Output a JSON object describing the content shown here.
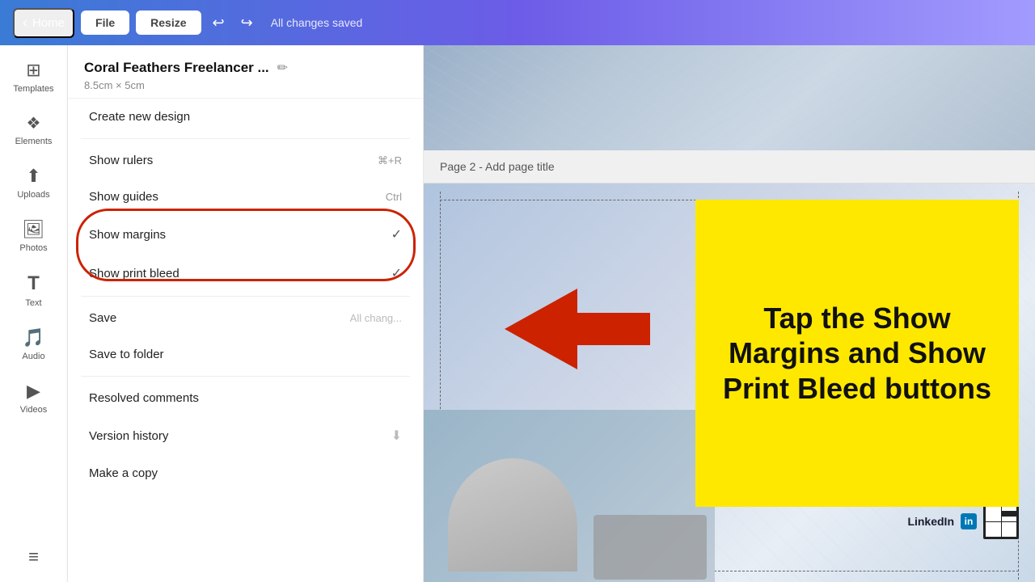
{
  "topbar": {
    "home_label": "Home",
    "file_label": "File",
    "resize_label": "Resize",
    "saved_status": "All changes saved",
    "undo_icon": "↩",
    "redo_icon": "↪",
    "chevron_left": "‹"
  },
  "sidebar": {
    "items": [
      {
        "id": "templates",
        "icon": "⊞",
        "label": "Templates"
      },
      {
        "id": "elements",
        "icon": "✦",
        "label": "Elements"
      },
      {
        "id": "uploads",
        "icon": "☁",
        "label": "Uploads"
      },
      {
        "id": "photos",
        "icon": "🖼",
        "label": "Photos"
      },
      {
        "id": "text",
        "icon": "T",
        "label": "Text"
      },
      {
        "id": "audio",
        "icon": "♪",
        "label": "Audio"
      },
      {
        "id": "videos",
        "icon": "▶",
        "label": "Videos"
      },
      {
        "id": "more",
        "icon": "≡",
        "label": ""
      }
    ]
  },
  "file_menu": {
    "title": "Coral Feathers Freelancer ...",
    "subtitle": "8.5cm × 5cm",
    "edit_icon": "✏",
    "items": [
      {
        "id": "create-new",
        "label": "Create new design",
        "shortcut": "",
        "check": false
      },
      {
        "id": "show-rulers",
        "label": "Show rulers",
        "shortcut": "⌘+R",
        "check": false
      },
      {
        "id": "show-guides",
        "label": "Show guides",
        "shortcut": "Ctrl",
        "check": false
      },
      {
        "id": "show-margins",
        "label": "Show margins",
        "shortcut": "",
        "check": true
      },
      {
        "id": "show-print-bleed",
        "label": "Show print bleed",
        "shortcut": "",
        "check": true
      },
      {
        "id": "save",
        "label": "Save",
        "faded": "All chang...",
        "check": false
      },
      {
        "id": "save-to-folder",
        "label": "Save to folder",
        "shortcut": "",
        "check": false
      },
      {
        "id": "resolved-comments",
        "label": "Resolved comments",
        "shortcut": "",
        "check": false
      },
      {
        "id": "version-history",
        "label": "Version history",
        "shortcut": "",
        "check": false
      },
      {
        "id": "make-copy",
        "label": "Make a copy",
        "shortcut": "",
        "check": false
      }
    ]
  },
  "canvas": {
    "page_title": "Page 2 - Add page title",
    "annotation": {
      "text": "Tap the Show Margins and Show Print Bleed buttons"
    }
  }
}
